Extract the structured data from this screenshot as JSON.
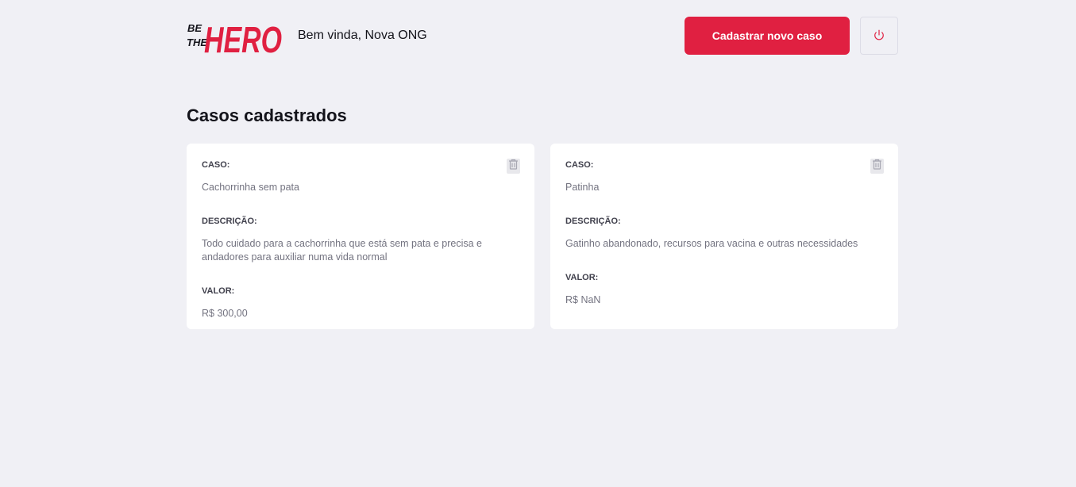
{
  "header": {
    "logo": {
      "line1": "BE",
      "line2": "THE",
      "word": "HERO"
    },
    "welcome": "Bem vinda, Nova ONG",
    "new_case_label": "Cadastrar novo caso",
    "logout_icon": "power-icon"
  },
  "main": {
    "title": "Casos cadastrados",
    "cases": [
      {
        "case_label": "CASO:",
        "case_value": "Cachorrinha sem pata",
        "description_label": "DESCRIÇÃO:",
        "description_value": "Todo cuidado para a cachorrinha que está sem pata e precisa e andadores para auxiliar numa vida normal",
        "value_label": "VALOR:",
        "value_value": "R$ 300,00",
        "delete_icon": "trash-icon"
      },
      {
        "case_label": "CASO:",
        "case_value": "Patinha",
        "description_label": "DESCRIÇÃO:",
        "description_value": "Gatinho abandonado, recursos para vacina e outras necessidades",
        "value_label": "VALOR:",
        "value_value": "R$ NaN",
        "delete_icon": "trash-icon"
      }
    ]
  },
  "colors": {
    "brand": "#e02041",
    "background": "#f0f0f5",
    "card": "#ffffff",
    "text_dark": "#13131a",
    "text_muted": "#737380"
  }
}
